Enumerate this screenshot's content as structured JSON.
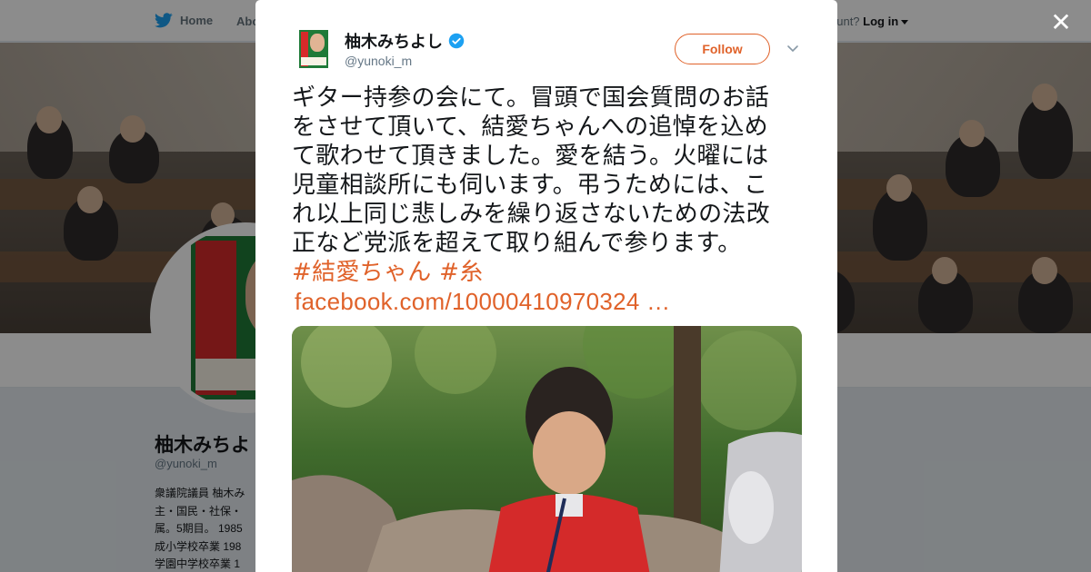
{
  "topnav": {
    "home_label": "Home",
    "about_label": "Abo",
    "login_prefix": "ccount?",
    "login_label": "Log in"
  },
  "profile": {
    "name": "柚木みちよ",
    "handle": "@yunoki_m",
    "bio": "衆議院議員 柚木み\n主・国民・社保・\n属。5期目。 1985\n成小学校卒業 198\n学園中学校卒業 1"
  },
  "modal": {
    "close_label": "✕",
    "author_name": "柚木みちよし",
    "author_handle": "@yunoki_m",
    "follow_label": "Follow",
    "tweet_lines": [
      "ギター持参の会にて。冒頭で国会質問のお話",
      "をさせて頂いて、結愛ちゃんへの追悼を込め",
      "て歌わせて頂きました。愛を結う。火曜には",
      "児童相談所にも伺います。弔うためには、こ",
      "れ以上同じ悲しみを繰り返さないための法改",
      "正など党派を超えて取り組んで参ります。"
    ],
    "hashtag_1": "#結愛ちゃん",
    "hashtag_2": "#糸",
    "link_text": "facebook.com/10000410970324 …"
  },
  "colors": {
    "accent": "#e0622a",
    "verified": "#1da1f2",
    "twitter_blue": "#1da1f2"
  },
  "icons": {
    "home": "twitter-bird-icon",
    "verified": "verified-badge-icon",
    "menu": "chevron-down-icon",
    "close": "close-icon"
  }
}
